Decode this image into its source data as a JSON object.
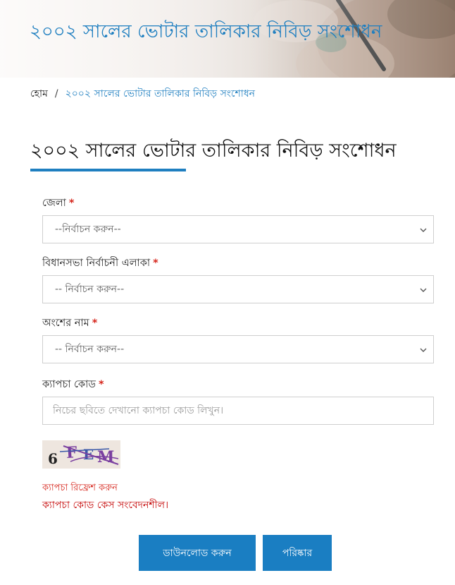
{
  "banner": {
    "title": "২০০২ সালের ভোটার তালিকার নিবিড় সংশোধন"
  },
  "breadcrumb": {
    "home": "হোম",
    "separator": "/",
    "current": "২০০২ সালের ভোটার তালিকার নিবিড় সংশোধন"
  },
  "page": {
    "title": "২০০২ সালের ভোটার তালিকার নিবিড় সংশোধন"
  },
  "form": {
    "required_marker": "*",
    "district": {
      "label": "জেলা",
      "selected": "--নির্বাচন করুন--"
    },
    "assembly": {
      "label": "বিধানসভা নির্বাচনী এলাকা",
      "selected": "-- নির্বাচন করুন--"
    },
    "part": {
      "label": "অংশের নাম",
      "selected": "-- নির্বাচন করুন--"
    },
    "captcha": {
      "label": "ক্যাপচা কোড",
      "value": "",
      "placeholder": "নিচের ছবিতে দেখানো ক্যাপচা কোড লিখুন।",
      "image_text": "6FEM",
      "refresh_label": "ক্যাপচা রিফ্রেশ করুন",
      "case_note": "ক্যাপচা কোড কেস সংবেদনশীল।"
    }
  },
  "actions": {
    "download_label": "ডাউনলোড করুন",
    "clear_label": "পরিষ্কার"
  },
  "colors": {
    "accent": "#1a7ec2",
    "link": "#1f7fc0",
    "required": "#d6261c",
    "note": "#c40000"
  }
}
